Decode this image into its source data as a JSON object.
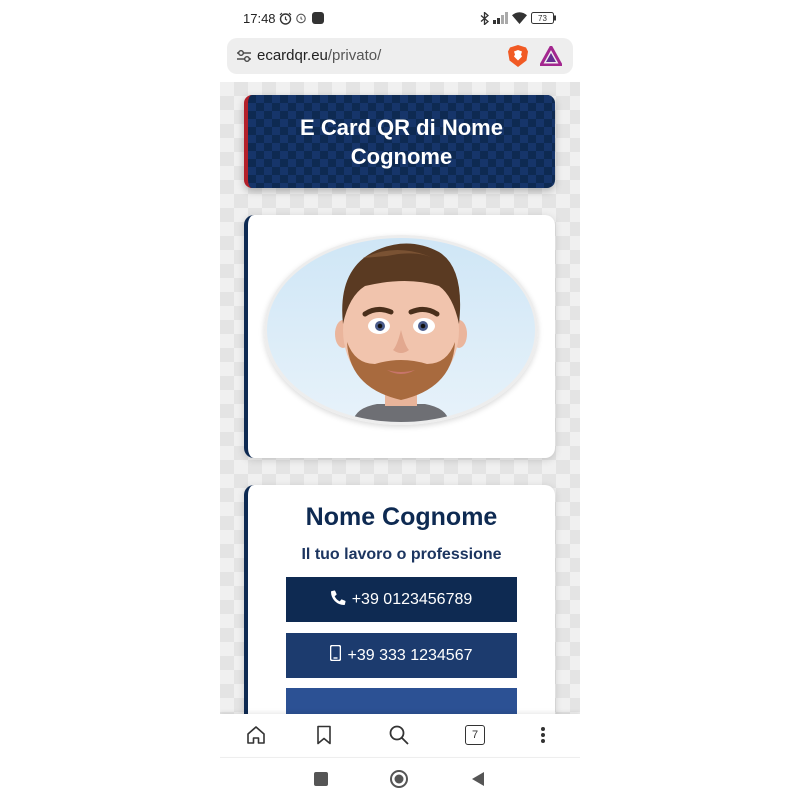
{
  "status_bar": {
    "time": "17:48",
    "battery": "73"
  },
  "browser": {
    "url_host": "ecardqr.eu",
    "url_path": "/privato/",
    "tab_count": "7"
  },
  "page": {
    "title": "E Card QR di Nome Cognome",
    "name": "Nome Cognome",
    "job": "Il tuo lavoro o professione",
    "phone_label": "+39 0123456789",
    "mobile_label": "+39 333 1234567"
  },
  "icons": {
    "status": [
      "alarm-icon",
      "alarm-icon",
      "app-notification-icon",
      "bluetooth-icon",
      "signal-icon",
      "wifi-icon",
      "battery-icon"
    ],
    "browser": [
      "site-settings-icon",
      "brave-shield-icon",
      "brave-rewards-icon"
    ],
    "nav": [
      "home-icon",
      "bookmark-icon",
      "search-icon",
      "tabs-icon",
      "more-menu-icon"
    ],
    "page": [
      "phone-icon",
      "mobile-phone-icon",
      "envelope-icon"
    ]
  },
  "colors": {
    "navy": "#0e2a52",
    "navy_mid": "#1c3b6e",
    "blue": "#2c5194",
    "accent_red": "#b3202a"
  }
}
